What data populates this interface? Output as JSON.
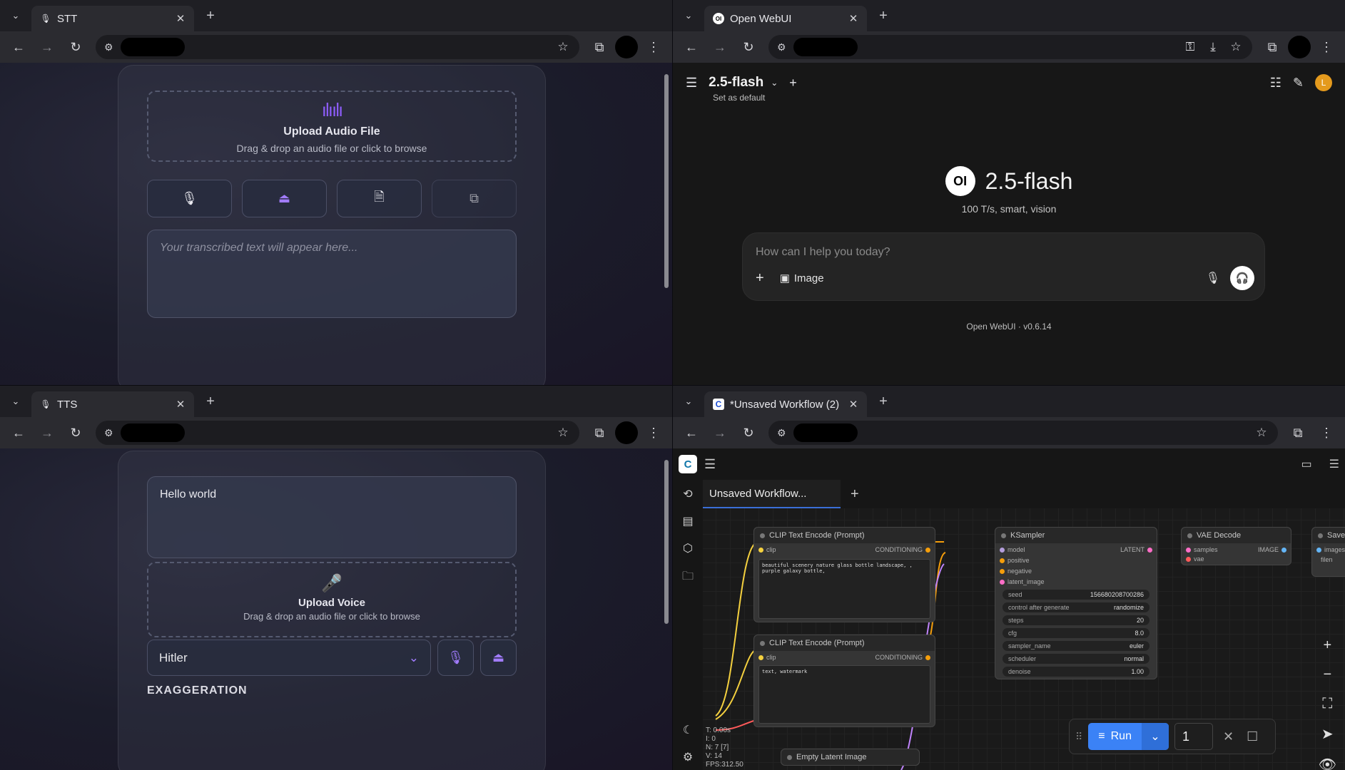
{
  "stt": {
    "tab_title": "STT",
    "upload": {
      "title": "Upload Audio File",
      "subtitle": "Drag & drop an audio file or click to browse"
    },
    "buttons": [
      "🎙",
      "⏏",
      "🗎",
      "⧉"
    ],
    "placeholder": "Your transcribed text will appear here..."
  },
  "openwebui": {
    "tab_title": "Open WebUI",
    "model": "2.5-flash",
    "set_default": "Set as default",
    "logo": "OI",
    "center_model": "2.5-flash",
    "description": "100 T/s, smart, vision",
    "input_placeholder": "How can I help you today?",
    "image_label": "Image",
    "avatar": "L",
    "version": "Open WebUI · v0.6.14"
  },
  "tts": {
    "tab_title": "TTS",
    "text_value": "Hello world",
    "upload": {
      "title": "Upload Voice",
      "subtitle": "Drag & drop an audio file or click to browse"
    },
    "voice": "Hitler",
    "section": "EXAGGERATION"
  },
  "comfy": {
    "tab_title": "*Unsaved Workflow (2)",
    "workflow_tab": "Unsaved Workflow...",
    "nodes": {
      "clip1": {
        "title": "CLIP Text Encode (Prompt)",
        "in": "clip",
        "out": "CONDITIONING",
        "text": "beautiful scenery nature glass bottle landscape, , purple galaxy bottle,"
      },
      "clip2": {
        "title": "CLIP Text Encode (Prompt)",
        "in": "clip",
        "out": "CONDITIONING",
        "text": "text, watermark"
      },
      "ksampler": {
        "title": "KSampler",
        "inputs": [
          "model",
          "positive",
          "negative",
          "latent_image"
        ],
        "out": "LATENT",
        "widgets": [
          {
            "name": "seed",
            "value": "156680208700286"
          },
          {
            "name": "control after generate",
            "value": "randomize"
          },
          {
            "name": "steps",
            "value": "20"
          },
          {
            "name": "cfg",
            "value": "8.0"
          },
          {
            "name": "sampler_name",
            "value": "euler"
          },
          {
            "name": "scheduler",
            "value": "normal"
          },
          {
            "name": "denoise",
            "value": "1.00"
          }
        ]
      },
      "vae": {
        "title": "VAE Decode",
        "inputs": [
          "samples",
          "vae"
        ],
        "out": "IMAGE"
      },
      "save": {
        "title": "Save",
        "inputs": [
          "images",
          "filen"
        ]
      },
      "latent": {
        "title": "Empty Latent Image"
      }
    },
    "stats": [
      "T: 0.00s",
      "I: 0",
      "N: 7 [7]",
      "V: 14",
      "FPS:312.50"
    ],
    "run_label": "Run",
    "queue_count": "1"
  },
  "colors": {
    "accent_purple": "#a27cff",
    "comfy_blue": "#3b82f6",
    "owui_avatar": "#e49a1d"
  }
}
